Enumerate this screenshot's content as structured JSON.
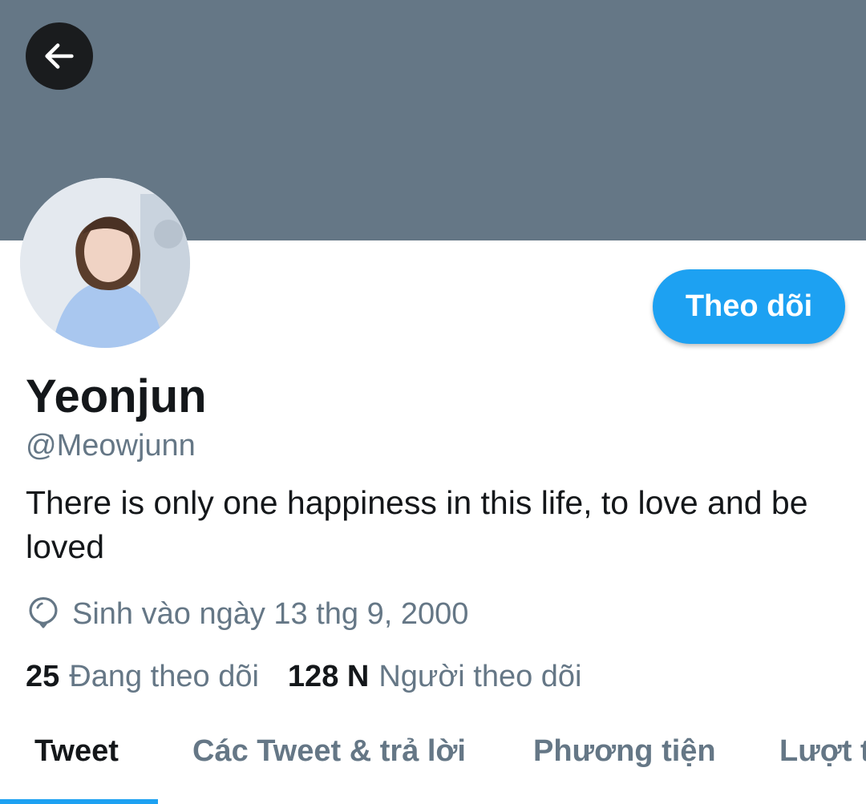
{
  "profile": {
    "display_name": "Yeonjun",
    "handle": "@Meowjunn",
    "bio": "There is only one happiness in this life, to love and be loved",
    "birthday": "Sinh vào ngày 13 thg 9, 2000"
  },
  "actions": {
    "follow_label": "Theo dõi"
  },
  "stats": {
    "following_count": "25",
    "following_label": "Đang theo dõi",
    "followers_count": "128 N",
    "followers_label": "Người theo dõi"
  },
  "tabs": [
    {
      "label": "Tweet",
      "active": true
    },
    {
      "label": "Các Tweet & trả lời",
      "active": false
    },
    {
      "label": "Phương tiện",
      "active": false
    },
    {
      "label": "Lượt thích",
      "active": false
    }
  ],
  "colors": {
    "banner": "#657786",
    "accent": "#1da1f2",
    "primary_text": "#14171a",
    "secondary_text": "#657786"
  },
  "icons": {
    "back": "arrow-left-icon",
    "birthday": "balloon-icon"
  }
}
